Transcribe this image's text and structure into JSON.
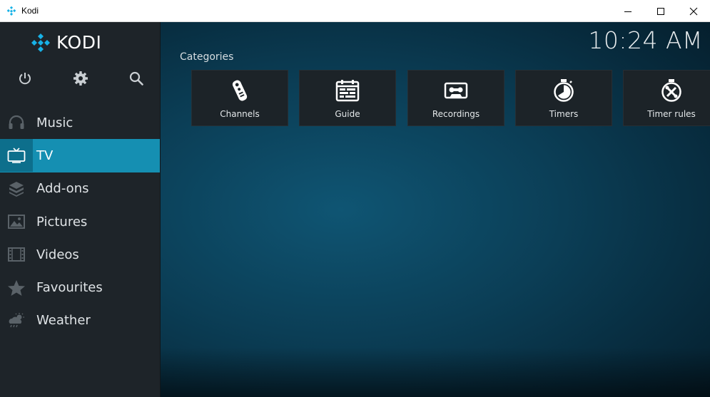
{
  "window": {
    "title": "Kodi"
  },
  "brand": {
    "name": "KODI"
  },
  "clock": {
    "time": "10:24 AM"
  },
  "top_icons": [
    "power-icon",
    "settings-icon",
    "search-icon"
  ],
  "menu": {
    "items": [
      {
        "label": "Music",
        "icon": "headphones-icon",
        "active": false
      },
      {
        "label": "TV",
        "icon": "tv-icon",
        "active": true
      },
      {
        "label": "Add-ons",
        "icon": "addons-box-icon",
        "active": false
      },
      {
        "label": "Pictures",
        "icon": "picture-icon",
        "active": false
      },
      {
        "label": "Videos",
        "icon": "film-strip-icon",
        "active": false
      },
      {
        "label": "Favourites",
        "icon": "star-icon",
        "active": false
      },
      {
        "label": "Weather",
        "icon": "weather-cloud-icon",
        "active": false
      }
    ]
  },
  "main": {
    "section_title": "Categories",
    "tiles": [
      {
        "label": "Channels",
        "icon": "remote-control-icon"
      },
      {
        "label": "Guide",
        "icon": "tv-guide-icon"
      },
      {
        "label": "Recordings",
        "icon": "cassette-icon"
      },
      {
        "label": "Timers",
        "icon": "stopwatch-icon"
      },
      {
        "label": "Timer rules",
        "icon": "timer-rules-icon"
      }
    ]
  },
  "colors": {
    "accent": "#158fb2",
    "sidebar": "#1e2429",
    "tile": "#1c2328",
    "logo_blue": "#17b2e7"
  }
}
